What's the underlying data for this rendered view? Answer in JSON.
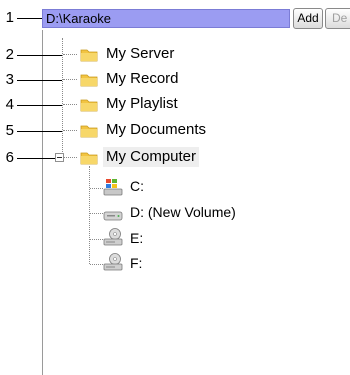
{
  "callouts": [
    "1",
    "2",
    "3",
    "4",
    "5",
    "6"
  ],
  "path_bar": {
    "value": "D:\\Karaoke"
  },
  "buttons": {
    "add_label": "Add",
    "delete_label": "De",
    "dropdown_glyph": "▼"
  },
  "tree": {
    "folders": [
      {
        "label": "My Server",
        "icon": "folder-icon"
      },
      {
        "label": "My Record",
        "icon": "folder-icon"
      },
      {
        "label": "My Playlist",
        "icon": "folder-icon"
      },
      {
        "label": "My Documents",
        "icon": "folder-icon"
      },
      {
        "label": "My Computer",
        "icon": "folder-icon",
        "expanded": true,
        "selected": true
      }
    ],
    "drives": [
      {
        "label": "C:",
        "icon": "windows-drive-icon"
      },
      {
        "label": "D: (New Volume)",
        "icon": "hard-drive-icon"
      },
      {
        "label": "E:",
        "icon": "optical-drive-icon"
      },
      {
        "label": "F:",
        "icon": "optical-drive-icon"
      }
    ]
  },
  "colors": {
    "path_bar_bg": "#9b9cf2",
    "folder": "#f2c442",
    "selection": "#eeeeee"
  }
}
